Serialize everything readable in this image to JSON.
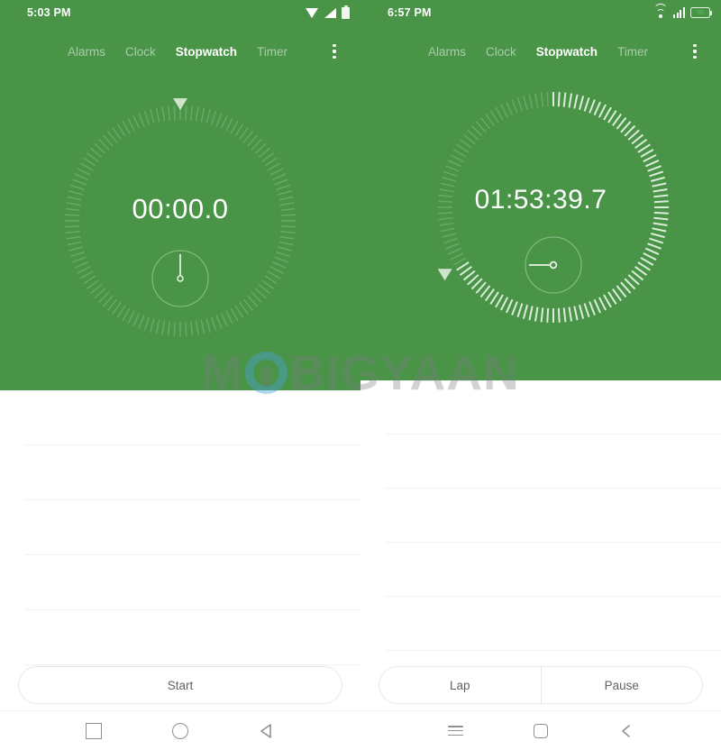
{
  "watermark": {
    "pre": "M",
    "post": "BIGYAAN",
    "logo_icon": "circle-logo-icon"
  },
  "panels": [
    {
      "id": "left",
      "status": {
        "time": "5:03 PM",
        "icons": [
          "wifi-icon",
          "signal-icon",
          "battery-icon"
        ],
        "battery_level": ""
      },
      "tabs": [
        {
          "label": "Alarms",
          "active": false
        },
        {
          "label": "Clock",
          "active": false
        },
        {
          "label": "Stopwatch",
          "active": true
        },
        {
          "label": "Timer",
          "active": false
        }
      ],
      "overflow_menu_icon": "more-vertical-icon",
      "stopwatch": {
        "display": "00:00.0",
        "progress_pct": 0,
        "marker_angle_deg": 0,
        "subdial_hand_angle_deg": 0,
        "running": false
      },
      "laps": [],
      "lap_row_count": 5,
      "actions": [
        {
          "label": "Start"
        }
      ],
      "navbar": [
        "square-icon",
        "circle-icon",
        "triangle-back-icon"
      ]
    },
    {
      "id": "right",
      "status": {
        "time": "6:57 PM",
        "icons": [
          "wifi-icon",
          "signal-icon",
          "battery-icon"
        ],
        "battery_level": "45"
      },
      "tabs": [
        {
          "label": "Alarms",
          "active": false
        },
        {
          "label": "Clock",
          "active": false
        },
        {
          "label": "Stopwatch",
          "active": true
        },
        {
          "label": "Timer",
          "active": false
        }
      ],
      "overflow_menu_icon": "more-vertical-icon",
      "stopwatch": {
        "display": "01:53:39.7",
        "progress_pct": 66,
        "marker_angle_deg": 238,
        "subdial_hand_angle_deg": 270,
        "running": true
      },
      "laps": [],
      "lap_row_count": 5,
      "actions": [
        {
          "label": "Lap"
        },
        {
          "label": "Pause"
        }
      ],
      "navbar": [
        "menu-icon",
        "square-rounded-icon",
        "chevron-back-icon"
      ]
    }
  ],
  "colors": {
    "brand_green": "#4a9448",
    "tick_dim": "#7ab478",
    "tick_bright": "#e4f0e3",
    "text_white": "#ffffff",
    "button_text": "#5e6368",
    "divider": "#f1f2f3"
  }
}
